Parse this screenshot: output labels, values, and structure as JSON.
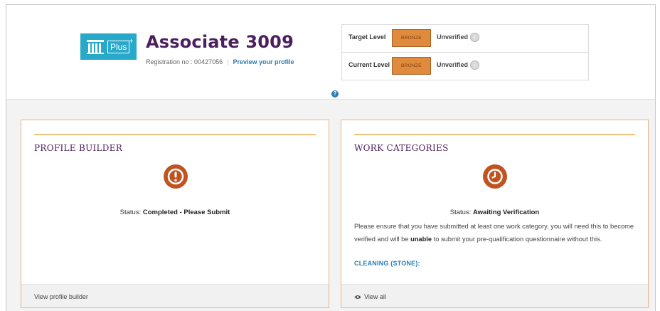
{
  "header": {
    "logo": {
      "text": "Plus",
      "sup": "+"
    },
    "title": "Associate 3009",
    "registration": "Registration no : 00427056",
    "preview_link": "Preview your profile",
    "help_icon": "?"
  },
  "levels": [
    {
      "label": "Target Level",
      "badge": "BRONZE",
      "status": "Unverified",
      "icon": "info-circle"
    },
    {
      "label": "Current Level",
      "badge": "BRONZE",
      "status": "Unverified",
      "icon": "info-circle"
    }
  ],
  "profile_builder": {
    "title": "PROFILE BUILDER",
    "status_prefix": "Status:",
    "status_value": "Completed - Please Submit",
    "icon": "exclamation-circle",
    "footer_link": "View profile builder"
  },
  "work_categories": {
    "title": "WORK CATEGORIES",
    "status_prefix": "Status:",
    "status_value": "Awaiting Verification",
    "icon": "clock",
    "message_before": "Please ensure that you have submitted at least one work category, you will need this to become verified and will be ",
    "message_bold": "unable",
    "message_after": " to submit your pre-qualification questionnaire without this.",
    "category": "CLEANING (STONE):",
    "footer_link": "View all"
  },
  "colors": {
    "brand_purple": "#4b1e5e",
    "link_blue": "#2a7db1",
    "bronze": "#e08a3e",
    "status_icon": "#c0531f",
    "card_rule": "#f5c27a",
    "logo_bg": "#29a9c9"
  }
}
